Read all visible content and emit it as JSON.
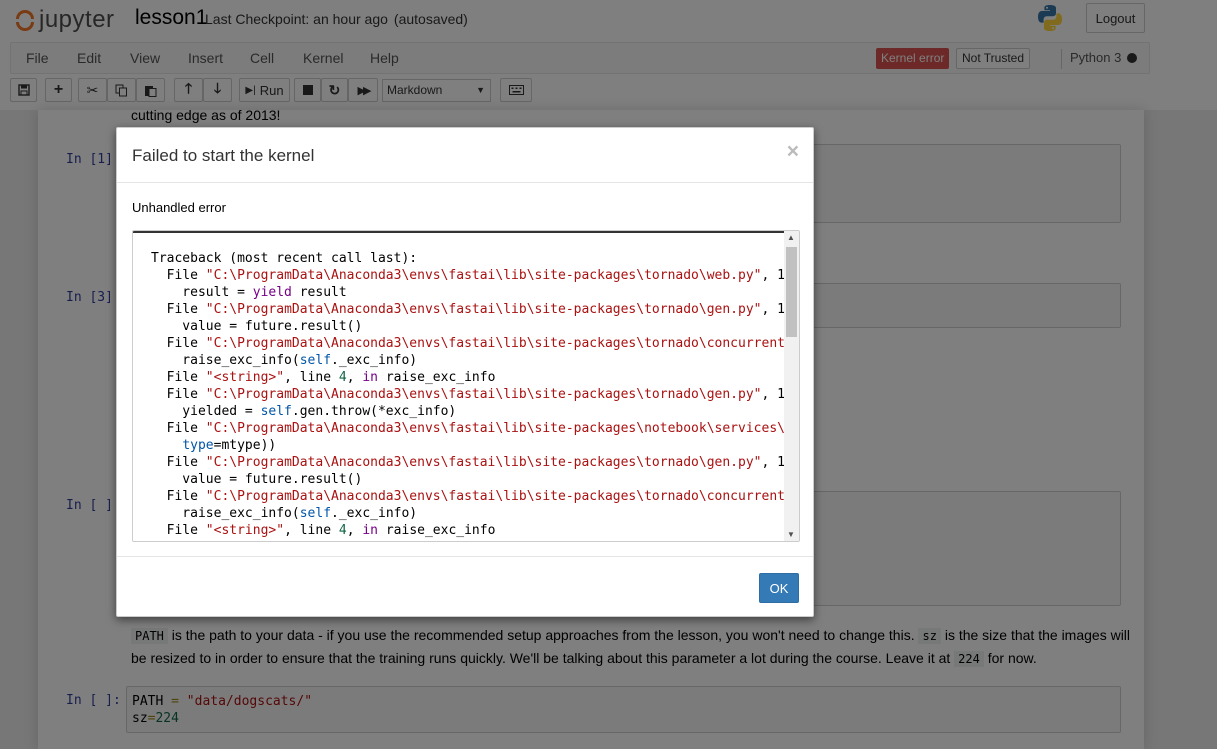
{
  "header": {
    "logo_text": "jupyter",
    "notebook_name": "lesson1",
    "checkpoint": "Last Checkpoint: an hour ago",
    "autosaved": "(autosaved)",
    "logout_label": "Logout"
  },
  "menubar": {
    "items": [
      "File",
      "Edit",
      "View",
      "Insert",
      "Cell",
      "Kernel",
      "Help"
    ],
    "kernel_error": "Kernel error",
    "not_trusted": "Not Trusted",
    "kernel_name": "Python 3"
  },
  "toolbar": {
    "run_label": "Run",
    "cell_type": "Markdown"
  },
  "notebook": {
    "top_text": "cutting edge as of 2013!",
    "prompt1": "In [1]:",
    "prompt3": "In [3]:",
    "prompt_empty": "In [ ]:",
    "prompt_last": "In [ ]:",
    "md_path": "PATH",
    "md_text1": "is the path to your data - if you use the recommended setup approaches from the lesson, you won't need to change this.",
    "md_sz": "sz",
    "md_text2": "is the size that the",
    "md_text3": "images will be resized to in order to ensure that the training runs quickly. We'll be talking about this parameter a lot during the course. Leave it at",
    "md_224": "224",
    "md_text4": "for now.",
    "code_path_var": "PATH",
    "code_path_op": " = ",
    "code_path_str": "\"data/dogscats/\"",
    "code_sz_var": "sz",
    "code_sz_op": "=",
    "code_sz_num": "224"
  },
  "modal": {
    "title": "Failed to start the kernel",
    "close": "×",
    "body_label": "Unhandled error",
    "ok_label": "OK",
    "traceback": {
      "l0": "Traceback (most recent call last):",
      "file": "  File ",
      "p_web": "\"C:\\ProgramData\\Anaconda3\\envs\\fastai\\lib\\site-packages\\tornado\\web.py\"",
      "p_gen": "\"C:\\ProgramData\\Anaconda3\\envs\\fastai\\lib\\site-packages\\tornado\\gen.py\"",
      "p_conc": "\"C:\\ProgramData\\Anaconda3\\envs\\fastai\\lib\\site-packages\\tornado\\concurrent",
      "p_serv": "\"C:\\ProgramData\\Anaconda3\\envs\\fastai\\lib\\site-packages\\notebook\\services\\",
      "p_string": "\"<string>\"",
      "tail_comma": ", 1",
      "line4": ", line ",
      "four": "4",
      "in_kw": "in",
      "rei": " raise_exc_info",
      "result_a": "    result = ",
      "yield_kw": "yield",
      "result_b": " result",
      "value_line": "    value = future.result()",
      "raise_a": "    raise_exc_info(",
      "self_kw": "self",
      "raise_b": "._exc_info)",
      "yielded_a": "    yielded = ",
      "yielded_b": ".gen.throw(*exc_info)",
      "type_a": "    ",
      "type_kw": "type",
      "type_b": "=mtype))"
    }
  },
  "colors": {
    "accent": "#337ab7",
    "kernel_error_bg": "#d9534f",
    "logo_orange": "#f37626",
    "prompt_blue": "#303f9f"
  }
}
